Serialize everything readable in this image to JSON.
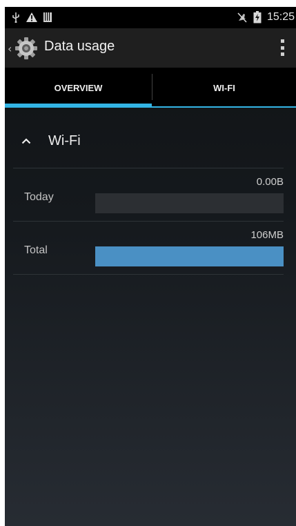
{
  "status_bar": {
    "left_icons": [
      "usb-icon",
      "warning-icon",
      "sd-card-icon"
    ],
    "right_icons": [
      "mute-icon",
      "battery-charging-icon"
    ],
    "time": "15:25"
  },
  "action_bar": {
    "title": "Data usage",
    "icons": [
      "chevron-left-icon",
      "settings-gear-icon",
      "overflow-menu-icon"
    ]
  },
  "tabs": [
    {
      "label": "OVERVIEW",
      "selected": true
    },
    {
      "label": "WI-FI",
      "selected": false
    }
  ],
  "section": {
    "label": "Wi-Fi",
    "expanded": true
  },
  "rows": [
    {
      "label": "Today",
      "value": "0.00B",
      "usage_fraction": 0.0
    },
    {
      "label": "Total",
      "value": "106MB",
      "usage_fraction": 1.0
    }
  ],
  "colors": {
    "accent": "#33b5e5",
    "usage_bar": "#4a90c4",
    "bar_track": "#2c2f33"
  }
}
